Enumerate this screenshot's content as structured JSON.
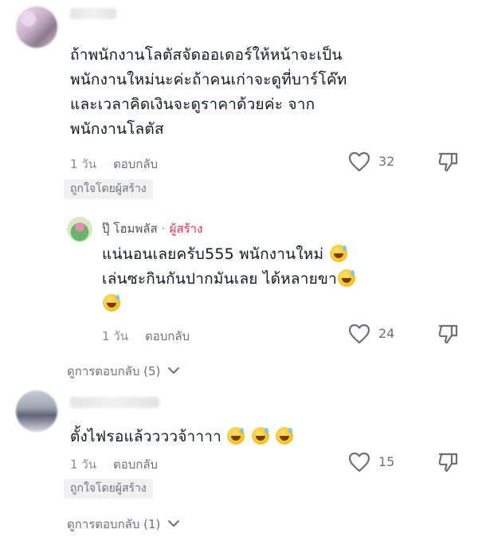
{
  "comments": [
    {
      "text_lines": [
        "ถ้าพนักงานโลตัสจัดออเดอร์ให้หน้าจะเป็น",
        "พนักงานใหม่นะค่ะถ้าคนเก่าจะดูที่บาร์โค๊ท",
        "และเวลาคิดเงินจะดูราคาด้วยค่ะ จาก",
        "พนักงานโลตัส"
      ],
      "time": "1 วัน",
      "reply_label": "ตอบกลับ",
      "likes": "32",
      "badge": "ถูกใจโดยผู้สร้าง"
    },
    {
      "text_lines": [
        "ตั้งไฟรอแล้ววววจ้าาาา"
      ],
      "time": "1 วัน",
      "reply_label": "ตอบกลับ",
      "likes": "15",
      "badge": "ถูกใจโดยผู้สร้าง",
      "view_replies": "ดูการตอบกลับ (1)"
    }
  ],
  "creator_reply": {
    "name": "ปุ๊ โฮมพลัส",
    "dot": "·",
    "tag": "ผู้สร้าง",
    "text_lines": [
      "แน่นอนเลยครับ555 พนักงานใหม่",
      "เล่นซะกินกันปากมันเลย ได้หลายขา"
    ],
    "time": "1 วัน",
    "reply_label": "ตอบกลับ",
    "likes": "24"
  },
  "view_replies_1": "ดูการตอบกลับ (5)",
  "icons": {
    "like": "heart-outline-icon",
    "dislike": "thumbs-down-icon",
    "expand": "chevron-down-icon",
    "emoji": "grinning-sweat-emoji-icon"
  },
  "colors": {
    "creator_tag": "#fe2c55",
    "muted_text": "#8a8b91",
    "badge_bg": "#f1f1f2"
  }
}
